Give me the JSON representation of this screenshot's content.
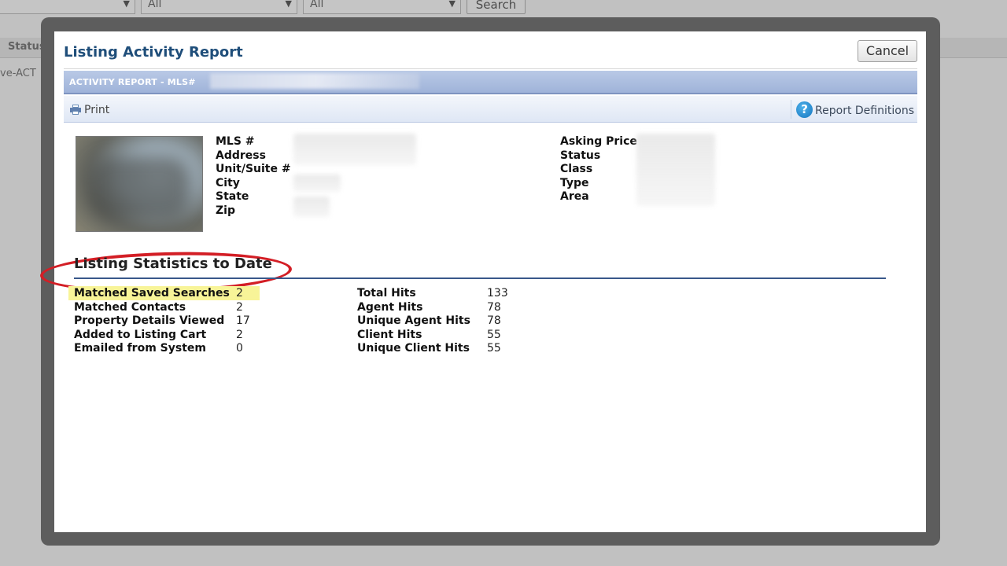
{
  "background": {
    "select1_value": "",
    "select2_value": "All",
    "select3_value": "All",
    "search_label": "Search",
    "column_status": "Status",
    "status_value": "ve-ACT"
  },
  "modal": {
    "title": "Listing Activity Report",
    "cancel_label": "Cancel",
    "report_bar_label": "ACTIVITY REPORT - MLS#",
    "print_label": "Print",
    "definitions_label": "Report Definitions"
  },
  "listing_info": {
    "left_labels": [
      "MLS #",
      "Address",
      "Unit/Suite #",
      "City",
      "State",
      "Zip"
    ],
    "right_labels": [
      "Asking Price",
      "Status",
      "Class",
      "Type",
      "Area"
    ]
  },
  "stats": {
    "title": "Listing Statistics to Date",
    "left": [
      {
        "label": "Matched Saved Searches",
        "value": "2"
      },
      {
        "label": "Matched Contacts",
        "value": "2"
      },
      {
        "label": "Property Details Viewed",
        "value": "17"
      },
      {
        "label": "Added to Listing Cart",
        "value": "2"
      },
      {
        "label": "Emailed from System",
        "value": "0"
      }
    ],
    "right": [
      {
        "label": "Total Hits",
        "value": "133"
      },
      {
        "label": "Agent Hits",
        "value": "78"
      },
      {
        "label": "Unique Agent Hits",
        "value": "78"
      },
      {
        "label": "Client Hits",
        "value": "55"
      },
      {
        "label": "Unique Client Hits",
        "value": "55"
      }
    ]
  },
  "colors": {
    "title_blue": "#1f4e7a",
    "annotation_red": "#d31e25",
    "highlight_yellow": "#f8f498",
    "rule_blue": "#38588a"
  }
}
